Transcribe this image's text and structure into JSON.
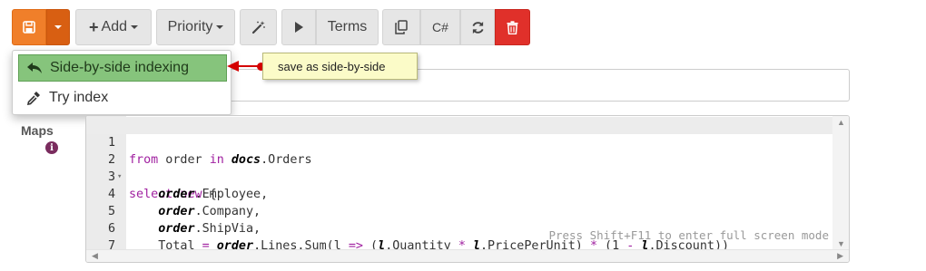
{
  "toolbar": {
    "add_label": "Add",
    "priority_label": "Priority",
    "terms_label": "Terms",
    "csharp_label": "C#"
  },
  "dropdown": {
    "items": [
      {
        "label": "Side-by-side indexing",
        "icon": "reply-arrow-icon",
        "active": true
      },
      {
        "label": "Try index",
        "icon": "eyedropper-icon",
        "active": false
      }
    ]
  },
  "callout": {
    "text": "save as side-by-side"
  },
  "maps": {
    "label": "Maps",
    "info_icon": "info-icon"
  },
  "editor": {
    "hint": "Press Shift+F11 to enter full screen mode",
    "lines": [
      {
        "n": "1",
        "text": "from order in docs.Orders"
      },
      {
        "n": "2",
        "text": "select new {"
      },
      {
        "n": "3",
        "text": "    order.Employee,"
      },
      {
        "n": "4",
        "text": "    order.Company,"
      },
      {
        "n": "5",
        "text": "    order.ShipVia,"
      },
      {
        "n": "6",
        "text": "    Total = order.Lines.Sum(l => (l.Quantity * l.PricePerUnit) * (1 - l.Discount))"
      },
      {
        "n": "7",
        "text": "}"
      }
    ]
  },
  "colors": {
    "save_orange": "#f07f2a",
    "delete_red": "#e0302a",
    "active_green": "#86c47c",
    "keyword_purple": "#a020a0",
    "callout_yellow": "#fbfbc8"
  }
}
